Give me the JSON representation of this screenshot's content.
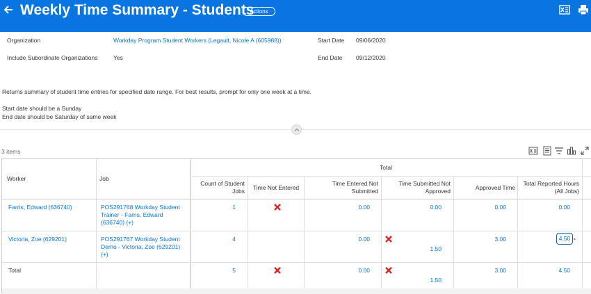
{
  "header": {
    "title": "Weekly Time Summary - Students",
    "actions_label": "Actions",
    "background_color": "#0875e1"
  },
  "prompts": {
    "organization_label": "Organization",
    "organization_value": "Workday Program Student Workers (Legault, Nicole A (605988))",
    "include_sub_label": "Include Subordinate Organizations",
    "include_sub_value": "Yes",
    "start_date_label": "Start Date",
    "start_date_value": "09/06/2020",
    "end_date_label": "End Date",
    "end_date_value": "09/12/2020"
  },
  "description": {
    "line1": "Returns summary of student time entries for specified date range. For best results, prompt for only one week at a time.",
    "line2": "Start date should be a Sunday",
    "line3": "End date should be Saturday of same week"
  },
  "grid": {
    "items_count": "3 items",
    "group_header": "Total",
    "columns": {
      "worker": "Worker",
      "job": "Job",
      "count": "Count of Student Jobs",
      "not_entered": "Time Not Entered",
      "entered_not_submitted": "Time Entered Not Submitted",
      "submitted_not_approved": "Time Submitted Not Approved",
      "approved": "Approved Time",
      "total_reported": "Total Reported Hours (All Jobs)"
    },
    "rows": [
      {
        "worker": "Farris, Edward (636740)",
        "job": "POS291768 Workday Student Trainer - Farris, Edward (636740) (+)",
        "count": "1",
        "not_entered": "x",
        "entered_not_submitted": "0.00",
        "submitted_not_approved": "0.00",
        "approved": "0.00",
        "total_reported": "0.00"
      },
      {
        "worker": "Victoria, Zoe (629201)",
        "job": "POS291767 Workday Student Demo - Victoria, Zoe (629201) (+)",
        "count": "4",
        "not_entered": "",
        "entered_not_submitted": "0.00",
        "submitted_not_approved": "1.50",
        "approved": "3.00",
        "total_reported": "4.50"
      },
      {
        "worker": "Total",
        "job": "",
        "count": "5",
        "not_entered": "x",
        "entered_not_submitted": "0.00",
        "submitted_not_approved": "1.50",
        "approved": "3.00",
        "total_reported": "4.50"
      }
    ]
  },
  "icons": {
    "back": "back-arrow-icon",
    "excel": "excel-export-icon",
    "print": "print-icon",
    "x_color": "#de2323",
    "link_color": "#0875e1"
  }
}
